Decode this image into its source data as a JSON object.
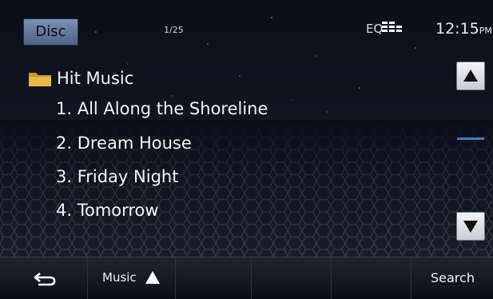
{
  "status_bar": {
    "source_label": "Disc",
    "track_count": "1/25",
    "eq_label": "EQ",
    "clock_time": "12:15",
    "clock_ampm": "PM"
  },
  "browser": {
    "folder_name": "Hit Music",
    "tracks": [
      "1. All Along the Shoreline",
      "2. Dream House",
      "3. Friday Night",
      "4. Tomorrow"
    ]
  },
  "bottom_bar": {
    "music_label": "Music",
    "search_label": "Search"
  },
  "icons": {
    "folder": "folder-icon",
    "eq": "equalizer-icon",
    "scroll_up": "arrow-up-icon",
    "scroll_down": "arrow-down-icon",
    "back": "back-arrow-icon",
    "music_up": "triangle-up-icon"
  },
  "colors": {
    "accent": "#4a78c2",
    "folder": "#e6b84a",
    "button": "#5a6e93"
  }
}
